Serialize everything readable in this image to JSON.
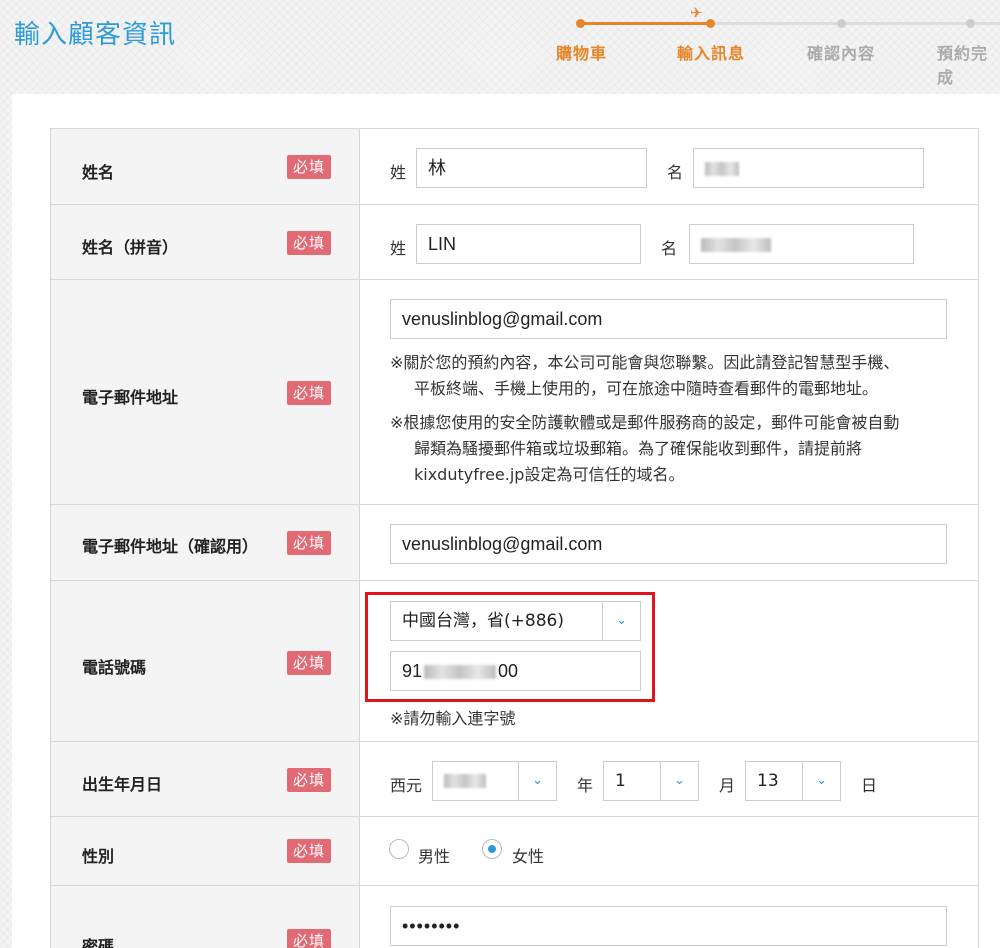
{
  "page_title": "輸入顧客資訊",
  "stepper": {
    "steps": [
      "購物車",
      "輸入訊息",
      "確認內容",
      "預約完成"
    ],
    "current_step": 2,
    "colors": {
      "active": "#e8852a",
      "inactive": "#cccccc"
    }
  },
  "required_label": "必填",
  "fields": {
    "name": {
      "label": "姓名",
      "last_label": "姓",
      "last_value": "林",
      "first_label": "名",
      "first_value": ""
    },
    "name_pinyin": {
      "label": "姓名（拼音）",
      "last_label": "姓",
      "last_value": "LIN",
      "first_label": "名",
      "first_value": ""
    },
    "email": {
      "label": "電子郵件地址",
      "value": "venuslinblog@gmail.com",
      "note1_line1": "※關於您的預約內容，本公司可能會與您聯繫。因此請登記智慧型手機、",
      "note1_line2": "平板終端、手機上使用的，可在旅途中隨時查看郵件的電郵地址。",
      "note2_line1": "※根據您使用的安全防護軟體或是郵件服務商的設定，郵件可能會被自動",
      "note2_line2": "歸類為騷擾郵件箱或垃圾郵箱。為了確保能收到郵件，請提前將",
      "note2_line3": "kixdutyfree.jp設定為可信任的域名。"
    },
    "email_confirm": {
      "label": "電子郵件地址（確認用）",
      "value": "venuslinblog@gmail.com"
    },
    "phone": {
      "label": "電話號碼",
      "country_value": "中國台灣，省(+886)",
      "number_prefix": "91",
      "number_suffix": "00",
      "note": "※請勿輸入連字號"
    },
    "birthday": {
      "label": "出生年月日",
      "era_label": "西元",
      "year_label": "年",
      "month_value": "1",
      "month_label": "月",
      "day_value": "13",
      "day_label": "日"
    },
    "gender": {
      "label": "性別",
      "options": [
        "男性",
        "女性"
      ],
      "selected": "女性"
    },
    "password": {
      "label": "密碼",
      "value": "••••••••"
    }
  },
  "highlight_color": "#e0141c",
  "accent_color": "#2d9bd6"
}
